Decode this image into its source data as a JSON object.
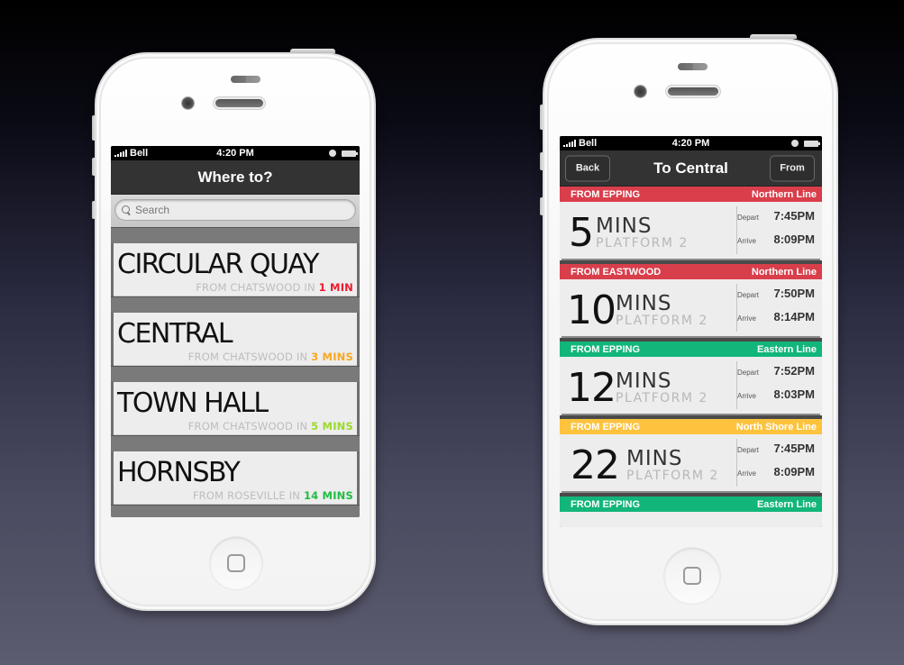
{
  "colors": {
    "northern": "#d93e4b",
    "eastern": "#12b67a",
    "north_shore": "#fdc33e",
    "eta_1": "#ee1b2e",
    "eta_3": "#f7a723",
    "eta_5": "#9cd92d",
    "eta_14": "#1fbd42"
  },
  "left_phone": {
    "status": {
      "carrier": "Bell",
      "time": "4:20 PM"
    },
    "nav": {
      "title": "Where to?"
    },
    "search": {
      "placeholder": "Search"
    },
    "destinations": [
      {
        "name": "CIRCULAR QUAY",
        "from": "FROM CHATSWOOD IN ",
        "eta": "1 MIN",
        "eta_color": "#ee1b2e"
      },
      {
        "name": "CENTRAL",
        "from": "FROM CHATSWOOD IN ",
        "eta": "3 MINS",
        "eta_color": "#f7a723"
      },
      {
        "name": "TOWN HALL",
        "from": "FROM CHATSWOOD IN ",
        "eta": "5 MINS",
        "eta_color": "#9cd92d"
      },
      {
        "name": "HORNSBY",
        "from": "FROM ROSEVILLE IN ",
        "eta": "14 MINS",
        "eta_color": "#1fbd42"
      }
    ]
  },
  "right_phone": {
    "status": {
      "carrier": "Bell",
      "time": "4:20 PM"
    },
    "nav": {
      "title": "To Central",
      "back_label": "Back",
      "from_label": "From"
    },
    "trips": [
      {
        "origin": "FROM EPPING",
        "line": "Northern Line",
        "line_color": "#d93e4b",
        "minutes": "5",
        "unit": "MINS",
        "platform": "PLATFORM 2",
        "depart_label": "Depart",
        "depart": "7:45PM",
        "arrive_label": "Arrive",
        "arrive": "8:09PM"
      },
      {
        "origin": "FROM EASTWOOD",
        "line": "Northern Line",
        "line_color": "#d93e4b",
        "minutes": "10",
        "unit": "MINS",
        "platform": "PLATFORM 2",
        "depart_label": "Depart",
        "depart": "7:50PM",
        "arrive_label": "Arrive",
        "arrive": "8:14PM"
      },
      {
        "origin": "FROM EPPING",
        "line": "Eastern Line",
        "line_color": "#12b67a",
        "minutes": "12",
        "unit": "MINS",
        "platform": "PLATFORM 2",
        "depart_label": "Depart",
        "depart": "7:52PM",
        "arrive_label": "Arrive",
        "arrive": "8:03PM"
      },
      {
        "origin": "FROM EPPING",
        "line": "North Shore Line",
        "line_color": "#fdc33e",
        "minutes": "22",
        "unit": "MINS",
        "platform": "PLATFORM 2",
        "depart_label": "Depart",
        "depart": "7:45PM",
        "arrive_label": "Arrive",
        "arrive": "8:09PM"
      },
      {
        "origin": "FROM EPPING",
        "line": "Eastern Line",
        "line_color": "#12b67a"
      }
    ]
  }
}
